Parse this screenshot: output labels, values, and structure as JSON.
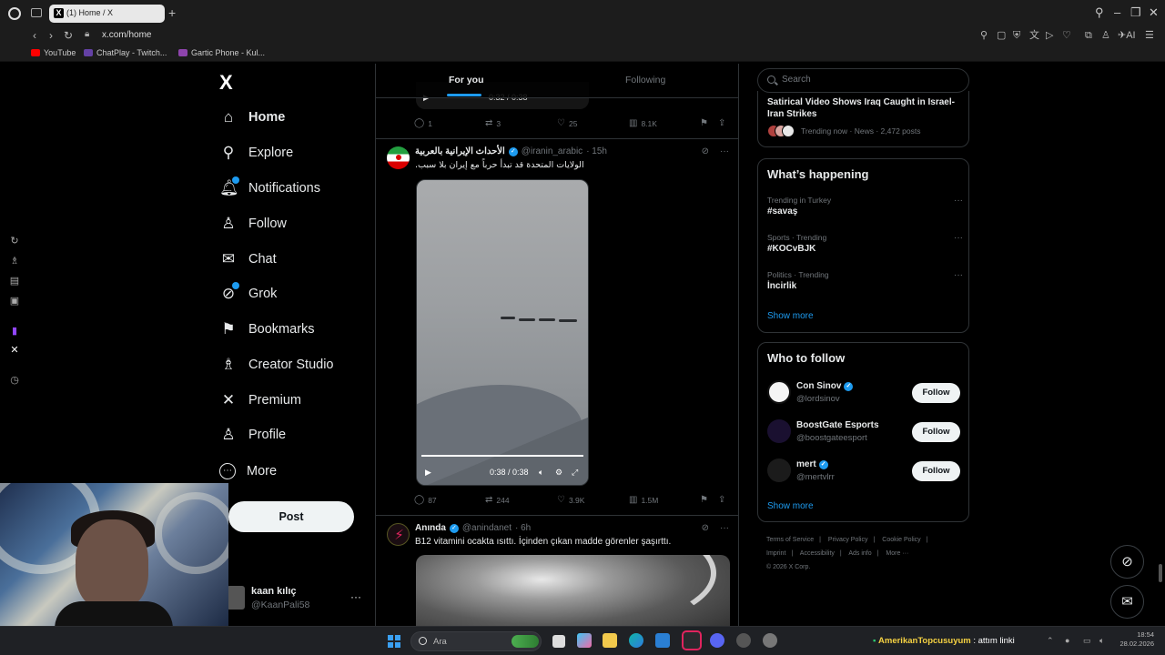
{
  "browser": {
    "tab_title": "(1) Home / X",
    "tab_favicon": "X",
    "url": "x.com/home",
    "bookmarks": [
      {
        "label": "YouTube",
        "color": "#ff0000"
      },
      {
        "label": "ChatPlay - Twitch...",
        "color": "#6441a5"
      },
      {
        "label": "Gartic Phone - Kul...",
        "color": "#8e44ad"
      }
    ],
    "extension_ai_label": "AI"
  },
  "nav": {
    "logo": "X",
    "items": [
      {
        "label": "Home",
        "icon": "home-icon",
        "glyph": "⌂"
      },
      {
        "label": "Explore",
        "icon": "search-icon",
        "glyph": "⚲"
      },
      {
        "label": "Notifications",
        "icon": "bell-icon",
        "glyph": "♪"
      },
      {
        "label": "Follow",
        "icon": "person-add-icon",
        "glyph": "♙"
      },
      {
        "label": "Chat",
        "icon": "mail-icon",
        "glyph": "✉"
      },
      {
        "label": "Grok",
        "icon": "grok-icon",
        "glyph": "⊘"
      },
      {
        "label": "Bookmarks",
        "icon": "bookmark-icon",
        "glyph": "⚑"
      },
      {
        "label": "Creator Studio",
        "icon": "creator-studio-icon",
        "glyph": "♗"
      },
      {
        "label": "Premium",
        "icon": "x-premium-icon",
        "glyph": "✕"
      },
      {
        "label": "Profile",
        "icon": "person-icon",
        "glyph": "♙"
      },
      {
        "label": "More",
        "icon": "more-circle-icon",
        "glyph": "⋯"
      }
    ],
    "post_button": "Post",
    "account": {
      "name": "kaan kılıç",
      "handle": "@KaanPali58",
      "more": "···"
    }
  },
  "timeline": {
    "tabs": [
      "For you",
      "Following"
    ],
    "active_tab": "For you",
    "prev_post": {
      "video_time": "0:32 / 0:38",
      "replies": "1",
      "reposts": "3",
      "likes": "25",
      "views": "8.1K"
    },
    "posts": [
      {
        "name": "الأحداث الإيرانية بالعربية",
        "handle": "@iranin_arabic",
        "time": "· 15h",
        "text": "الولايات المتحدة قد تبدأ حرباً مع إيران بلا سبب.",
        "video_time": "0:38 / 0:38",
        "video_progress": 1.0,
        "replies": "87",
        "reposts": "244",
        "likes": "3.9K",
        "views": "1.5M"
      },
      {
        "name": "Anında",
        "handle": "@anindanet",
        "time": "· 6h",
        "text": "B12 vitamini ocakta ısıttı. İçinden çıkan madde görenler şaşırttı."
      }
    ]
  },
  "right": {
    "search_placeholder": "Search",
    "news": {
      "title": "Satirical Video Shows Iraq Caught in Israel-Iran Strikes",
      "meta": "Trending now · News · 2,472 posts"
    },
    "happening": {
      "title": "What’s happening",
      "trends": [
        {
          "context": "Trending in Turkey",
          "tag": "#savaş"
        },
        {
          "context": "Sports · Trending",
          "tag": "#KOCvBJK"
        },
        {
          "context": "Politics · Trending",
          "tag": "İncirlik"
        }
      ],
      "show_more": "Show more"
    },
    "who_to_follow": {
      "title": "Who to follow",
      "users": [
        {
          "name": "Con Sinov",
          "handle": "@lordsinov",
          "button": "Follow"
        },
        {
          "name": "BoostGate Esports",
          "handle": "@boostgateesport",
          "button": "Follow"
        },
        {
          "name": "mert",
          "handle": "@mertvlrr",
          "button": "Follow"
        }
      ],
      "show_more": "Show more"
    },
    "footer": {
      "links": [
        "Terms of Service",
        "|",
        "Privacy Policy",
        "|",
        "Cookie Policy",
        "|",
        "Imprint",
        "|",
        "Accessibility",
        "|",
        "Ads info",
        "|",
        "More ···"
      ],
      "copyright": "© 2026 X Corp."
    }
  },
  "taskbar": {
    "search_text": "Ara",
    "ticker_user": "AmerikanTopcusuyum",
    "ticker_message": ": attım linki",
    "clock_time": "18:54",
    "clock_date": "28.02.2026"
  },
  "colors": {
    "accent": "#1d9bf0",
    "background": "#000000",
    "border": "#2f3336",
    "muted_text": "#71767b"
  }
}
